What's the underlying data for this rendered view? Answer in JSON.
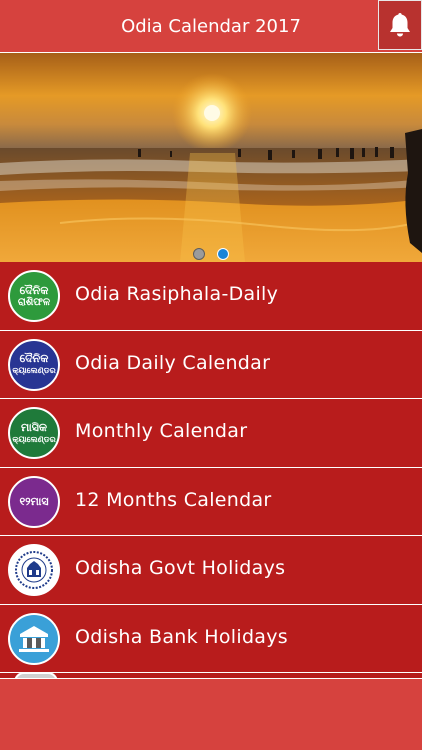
{
  "header": {
    "title": "Odia Calendar 2017",
    "notification_icon": "bell-icon"
  },
  "banner": {
    "image": "sunset-beach-photo",
    "slide_count": 2,
    "active_slide": 2,
    "colors": {
      "dot_inactive": "#9b9b9b",
      "dot_active": "#1b84d6"
    }
  },
  "menu": {
    "items": [
      {
        "label": "Odia Rasiphala-Daily",
        "icon": "rasiphala-badge-icon",
        "icon_text": [
          "ଦୈନିକ",
          "ରାଶିଫଳ"
        ],
        "icon_color": "#2e9a3c"
      },
      {
        "label": "Odia Daily Calendar",
        "icon": "daily-calendar-badge-icon",
        "icon_text": [
          "ଦୈନିକ",
          "କ୍ୟାଲେଣ୍ଡର"
        ],
        "icon_color": "#283593"
      },
      {
        "label": "Monthly Calendar",
        "icon": "monthly-calendar-badge-icon",
        "icon_text": [
          "ମାସିକ",
          "କ୍ୟାଲେଣ୍ଡର"
        ],
        "icon_color": "#1f7a3a"
      },
      {
        "label": "12 Months Calendar",
        "icon": "twelve-months-badge-icon",
        "icon_text": [
          "୧୨ମାସ",
          ""
        ],
        "icon_color": "#7b2a8e"
      },
      {
        "label": "Odisha Govt Holidays",
        "icon": "odisha-govt-emblem-icon",
        "icon_text": [
          "",
          ""
        ],
        "icon_color": "#ffffff"
      },
      {
        "label": "Odisha Bank Holidays",
        "icon": "bank-building-icon",
        "icon_text": [
          "",
          ""
        ],
        "icon_color": "#3aa0d8"
      }
    ]
  },
  "colors": {
    "header": "#d6423e",
    "menu_background": "#b81c1c",
    "text": "#ffffff"
  }
}
